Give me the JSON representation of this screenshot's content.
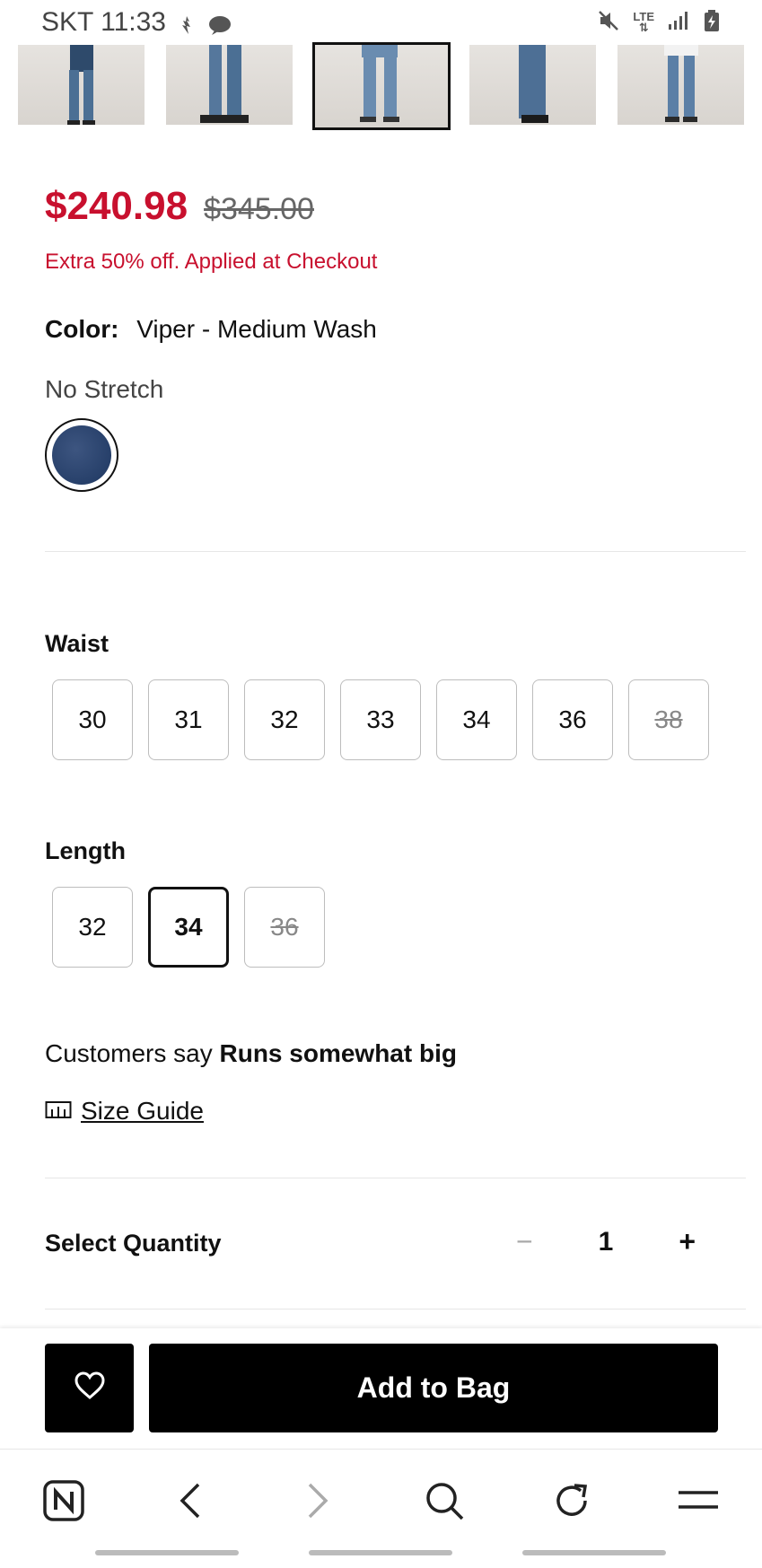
{
  "status_bar": {
    "carrier_time": "SKT 11:33",
    "network": "LTE"
  },
  "thumbnails": [
    {
      "name": "thumb-1",
      "selected": false
    },
    {
      "name": "thumb-2",
      "selected": false
    },
    {
      "name": "thumb-3",
      "selected": true
    },
    {
      "name": "thumb-4",
      "selected": false
    },
    {
      "name": "thumb-5",
      "selected": false
    }
  ],
  "price": {
    "sale": "$240.98",
    "original": "$345.00",
    "promo": "Extra 50% off. Applied at Checkout"
  },
  "color": {
    "label": "Color:",
    "value": "Viper - Medium Wash",
    "stretch": "No Stretch",
    "swatch_color": "#2b4470"
  },
  "waist": {
    "label": "Waist",
    "sizes": [
      {
        "value": "30",
        "available": true,
        "selected": false
      },
      {
        "value": "31",
        "available": true,
        "selected": false
      },
      {
        "value": "32",
        "available": true,
        "selected": false
      },
      {
        "value": "33",
        "available": true,
        "selected": false
      },
      {
        "value": "34",
        "available": true,
        "selected": false
      },
      {
        "value": "36",
        "available": true,
        "selected": false
      },
      {
        "value": "38",
        "available": false,
        "selected": false
      }
    ]
  },
  "length": {
    "label": "Length",
    "sizes": [
      {
        "value": "32",
        "available": true,
        "selected": false
      },
      {
        "value": "34",
        "available": true,
        "selected": true
      },
      {
        "value": "36",
        "available": false,
        "selected": false
      }
    ]
  },
  "fit": {
    "prefix": "Customers say",
    "value": "Runs somewhat big"
  },
  "size_guide": {
    "label": "Size Guide"
  },
  "quantity": {
    "label": "Select Quantity",
    "minus": "−",
    "value": "1",
    "plus": "+"
  },
  "actions": {
    "add_to_bag": "Add to Bag"
  },
  "colors": {
    "sale_red": "#c8102e",
    "button_black": "#000000"
  }
}
